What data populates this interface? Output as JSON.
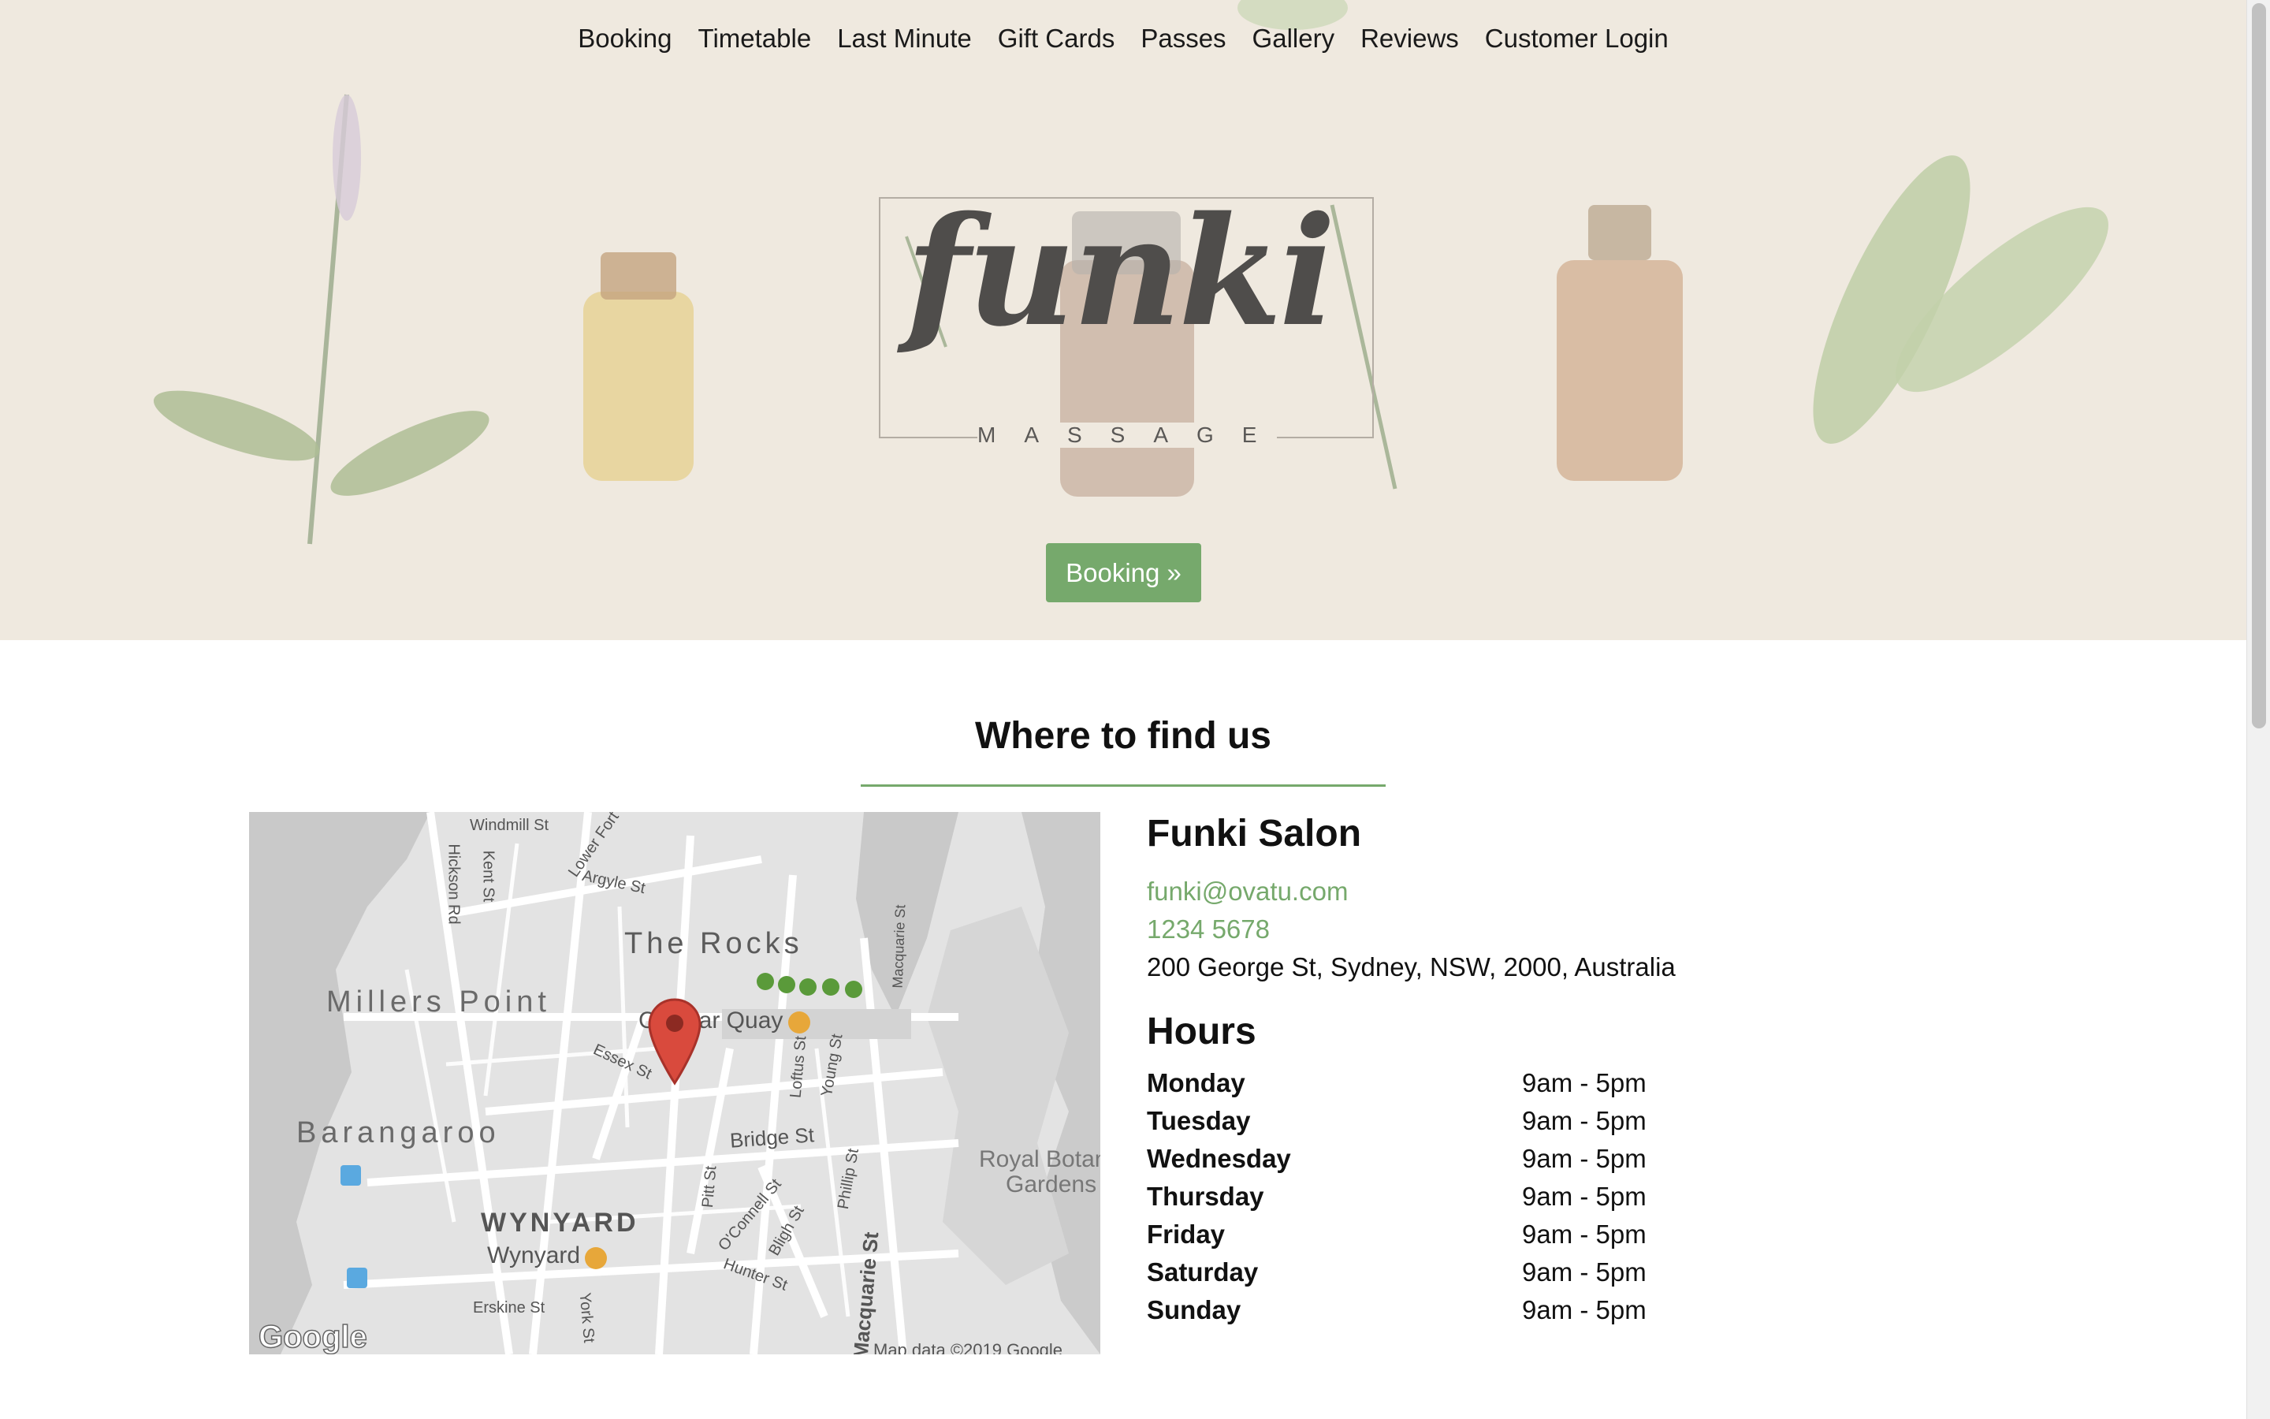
{
  "nav": {
    "items": [
      "Booking",
      "Timetable",
      "Last Minute",
      "Gift Cards",
      "Passes",
      "Gallery",
      "Reviews",
      "Customer Login"
    ]
  },
  "hero": {
    "logo_word": "funki",
    "logo_subtitle": "MASSAGE",
    "booking_button": "Booking »"
  },
  "find_us": {
    "title": "Where to find us"
  },
  "map": {
    "labels": {
      "the_rocks": "The Rocks",
      "millers_point": "Millers Point",
      "barangaroo": "Barangaroo",
      "wynyard_area": "WYNYARD",
      "wynyard_station": "Wynyard",
      "circular_quay": "Circular Quay",
      "bridge_st": "Bridge St",
      "royal_botanic": "Royal Botanic",
      "gardens": "Gardens",
      "windmill_st": "Windmill St",
      "argyle_st": "Argyle St",
      "kent_st": "Kent St",
      "hickson_rd": "Hickson Rd",
      "lower_fort": "Lower Fort",
      "essex_st": "Essex St",
      "loftus_st": "Loftus St",
      "young_st": "Young St",
      "macquarie_st_top": "Macquarie St",
      "macquarie_st": "Macquarie St",
      "pitt_st": "Pitt St",
      "oconnell_st": "O'Connell St",
      "bligh_st": "Bligh St",
      "hunter_st": "Hunter St",
      "phillip_st": "Phillip St",
      "erskine_st": "Erskine St",
      "york_st": "York St",
      "google": "Google",
      "map_data": "Map data ©2019 Google"
    }
  },
  "contact": {
    "name": "Funki Salon",
    "email": "funki@ovatu.com",
    "phone": "1234 5678",
    "address": "200 George St, Sydney, NSW, 2000, Australia"
  },
  "hours": {
    "title": "Hours",
    "rows": [
      {
        "day": "Monday",
        "time": "9am - 5pm"
      },
      {
        "day": "Tuesday",
        "time": "9am - 5pm"
      },
      {
        "day": "Wednesday",
        "time": "9am - 5pm"
      },
      {
        "day": "Thursday",
        "time": "9am - 5pm"
      },
      {
        "day": "Friday",
        "time": "9am - 5pm"
      },
      {
        "day": "Saturday",
        "time": "9am - 5pm"
      },
      {
        "day": "Sunday",
        "time": "9am - 5pm"
      }
    ]
  },
  "colors": {
    "accent": "#76a96c",
    "hero_bg": "#efe9df",
    "map_pin": "#d94a3d"
  },
  "icons": [
    "map-pin-icon",
    "ferry-icon",
    "train-icon",
    "bus-icon"
  ]
}
